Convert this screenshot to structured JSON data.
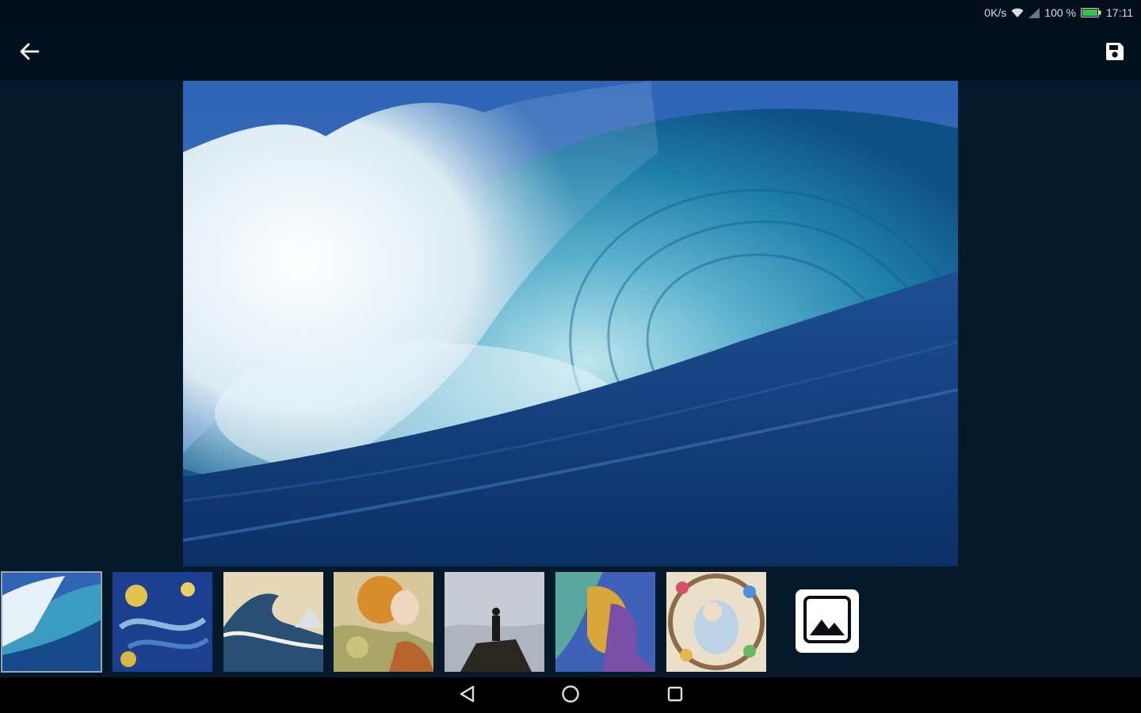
{
  "status_bar": {
    "network_speed": "0K/s",
    "battery_percent": "100 %",
    "time": "17:11",
    "icons": [
      "wifi-icon",
      "signal-icon",
      "battery-icon"
    ],
    "battery_color": "#38c24a"
  },
  "app_bar": {
    "back_icon": "arrow-left-icon",
    "save_icon": "floppy-disk-icon"
  },
  "main_image": {
    "subject": "breaking ocean wave"
  },
  "style_strip": {
    "thumbnails": [
      {
        "name": "wave-photo",
        "selected": true
      },
      {
        "name": "starry-night",
        "selected": false
      },
      {
        "name": "great-wave",
        "selected": false
      },
      {
        "name": "art-nouveau-portrait",
        "selected": false
      },
      {
        "name": "wanderer-above-fog",
        "selected": false
      },
      {
        "name": "colorful-abstract-portrait",
        "selected": false
      },
      {
        "name": "stained-glass-portrait",
        "selected": false
      }
    ],
    "gallery_icon": "image-icon"
  },
  "nav_bar": {
    "icons": [
      "back-triangle-icon",
      "home-circle-icon",
      "recents-square-icon"
    ]
  },
  "colors": {
    "background": "#041a2b",
    "app_bar": "#02111d",
    "status_bar": "#010f1a"
  }
}
